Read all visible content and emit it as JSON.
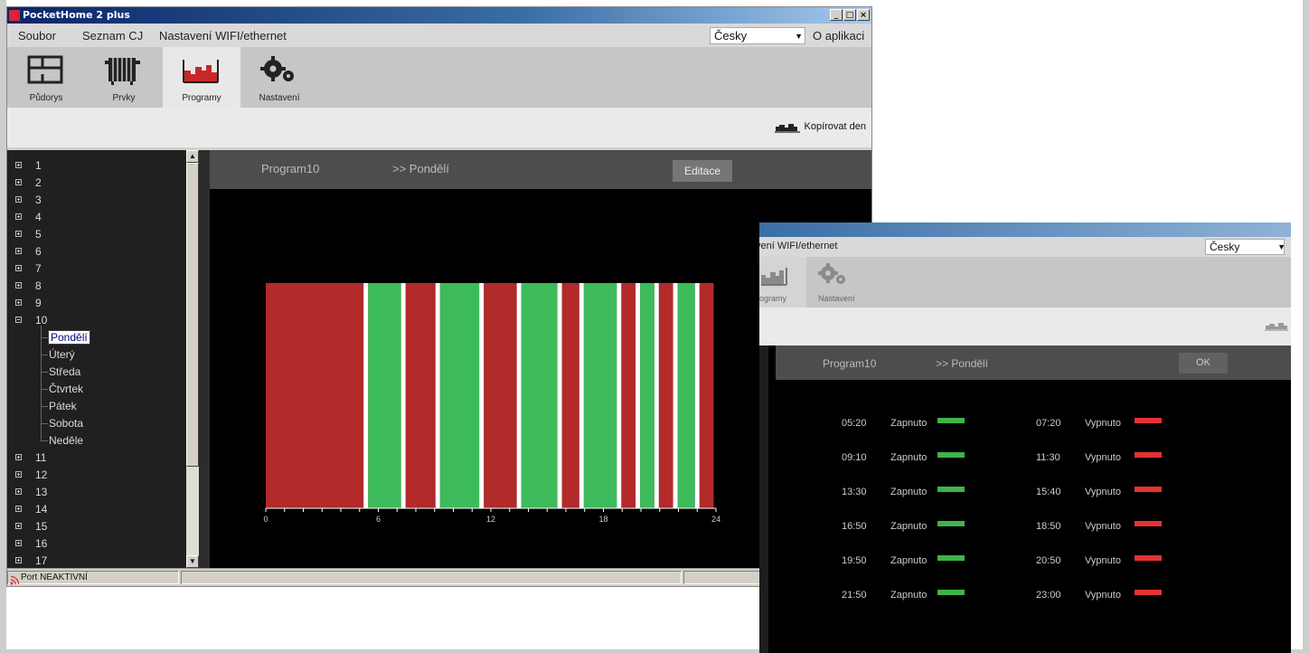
{
  "window": {
    "title": "PocketHome 2 plus",
    "min": "_",
    "max": "□",
    "close": "×"
  },
  "menu": {
    "items": [
      "Soubor",
      "Seznam CJ",
      "Nastavení WIFI/ethernet"
    ],
    "language": "Česky",
    "about": "O aplikaci"
  },
  "toolbar": {
    "items": [
      "Půdorys",
      "Prvky",
      "Programy",
      "Nastavení"
    ],
    "active": "Programy"
  },
  "subbar": {
    "copy_day": "Kopírovat den"
  },
  "tree": {
    "top_nodes": [
      "1",
      "2",
      "3",
      "4",
      "5",
      "6",
      "7",
      "8",
      "9"
    ],
    "expanded_node": "10",
    "days": [
      "Pondělí",
      "Úterý",
      "Středa",
      "Čtvrtek",
      "Pátek",
      "Sobota",
      "Neděle"
    ],
    "selected_day": "Pondělí",
    "bottom_nodes": [
      "11",
      "12",
      "13",
      "14",
      "15",
      "16",
      "17"
    ]
  },
  "program": {
    "name": "Program10",
    "day": ">> Pondělí",
    "edit_button": "Editace"
  },
  "chart_data": {
    "type": "timeline",
    "x_ticks": [
      "0",
      "6",
      "12",
      "18",
      "24"
    ],
    "xlim": [
      0,
      24
    ],
    "on_color": "#3dbb5a",
    "off_color": "#b22a2a",
    "on_intervals": [
      {
        "start": "05:20",
        "end": "07:20"
      },
      {
        "start": "09:10",
        "end": "11:30"
      },
      {
        "start": "13:30",
        "end": "15:40"
      },
      {
        "start": "16:50",
        "end": "18:50"
      },
      {
        "start": "19:50",
        "end": "20:50"
      },
      {
        "start": "21:50",
        "end": "23:00"
      }
    ]
  },
  "status": {
    "port": "Port NEAKTIVNÍ"
  },
  "edit_window": {
    "menu_fragment": "vení WIFI/ethernet",
    "language": "Česky",
    "tools": [
      "ogramy",
      "Nastavení"
    ],
    "program": "Program10",
    "day": ">> Pondělí",
    "ok_button": "OK",
    "schedule": [
      {
        "on_time": "05:20",
        "on_label": "Zapnuto",
        "off_time": "07:20",
        "off_label": "Vypnuto"
      },
      {
        "on_time": "09:10",
        "on_label": "Zapnuto",
        "off_time": "11:30",
        "off_label": "Vypnuto"
      },
      {
        "on_time": "13:30",
        "on_label": "Zapnuto",
        "off_time": "15:40",
        "off_label": "Vypnuto"
      },
      {
        "on_time": "16:50",
        "on_label": "Zapnuto",
        "off_time": "18:50",
        "off_label": "Vypnuto"
      },
      {
        "on_time": "19:50",
        "on_label": "Zapnuto",
        "off_time": "20:50",
        "off_label": "Vypnuto"
      },
      {
        "on_time": "21:50",
        "on_label": "Zapnuto",
        "off_time": "23:00",
        "off_label": "Vypnuto"
      }
    ]
  }
}
